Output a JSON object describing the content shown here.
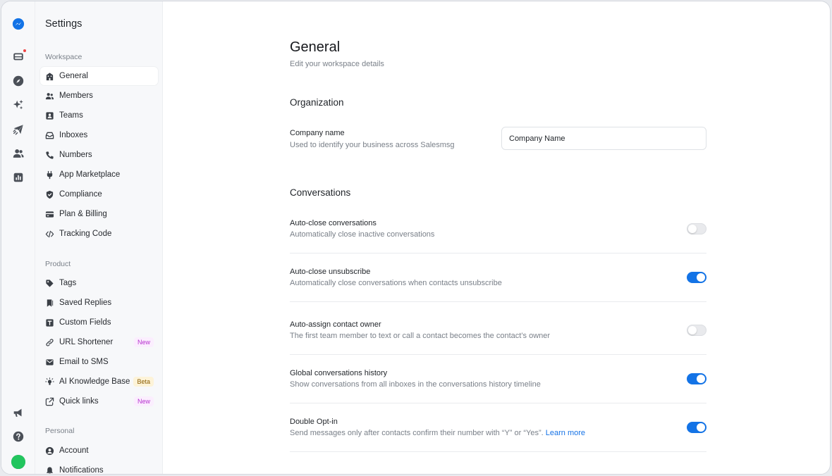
{
  "sidebar": {
    "title": "Settings",
    "sections": [
      {
        "label": "Workspace",
        "items": [
          {
            "label": "General",
            "icon": "building-icon",
            "active": true
          },
          {
            "label": "Members",
            "icon": "users-icon"
          },
          {
            "label": "Teams",
            "icon": "id-card-icon"
          },
          {
            "label": "Inboxes",
            "icon": "inbox-icon"
          },
          {
            "label": "Numbers",
            "icon": "phone-icon"
          },
          {
            "label": "App Marketplace",
            "icon": "plug-icon"
          },
          {
            "label": "Compliance",
            "icon": "shield-check-icon"
          },
          {
            "label": "Plan & Billing",
            "icon": "credit-card-icon"
          },
          {
            "label": "Tracking Code",
            "icon": "code-icon"
          }
        ]
      },
      {
        "label": "Product",
        "items": [
          {
            "label": "Tags",
            "icon": "tag-icon"
          },
          {
            "label": "Saved Replies",
            "icon": "bookmark-icon"
          },
          {
            "label": "Custom Fields",
            "icon": "text-field-icon"
          },
          {
            "label": "URL Shortener",
            "icon": "link-icon",
            "badge": "New"
          },
          {
            "label": "Email to SMS",
            "icon": "envelope-icon"
          },
          {
            "label": "AI Knowledge Base",
            "icon": "lightbulb-icon",
            "badge": "Beta"
          },
          {
            "label": "Quick links",
            "icon": "external-link-icon",
            "badge": "New"
          }
        ]
      },
      {
        "label": "Personal",
        "items": [
          {
            "label": "Account",
            "icon": "user-circle-icon"
          },
          {
            "label": "Notifications",
            "icon": "bell-icon"
          }
        ]
      }
    ]
  },
  "main": {
    "title": "General",
    "subtitle": "Edit your workspace details",
    "organization": {
      "title": "Organization",
      "company_name_label": "Company name",
      "company_name_help": "Used to identify your business across Salesmsg",
      "company_name_value": "Company Name"
    },
    "conversations": {
      "title": "Conversations",
      "settings": [
        {
          "label": "Auto-close conversations",
          "help": "Automatically close inactive conversations",
          "enabled": false
        },
        {
          "label": "Auto-close unsubscribe",
          "help": "Automatically close conversations when contacts unsubscribe",
          "enabled": true
        },
        {
          "label": "Auto-assign contact owner",
          "help": "The first team member to text or call a contact becomes the contact’s owner",
          "enabled": false
        },
        {
          "label": "Global conversations history",
          "help": "Show conversations from all inboxes in the conversations history timeline",
          "enabled": true
        },
        {
          "label": "Double Opt-in",
          "help": "Send messages only after contacts confirm their number with “Y” or “Yes”.",
          "link": "Learn more",
          "enabled": true
        }
      ]
    }
  },
  "colors": {
    "accent": "#1373e6",
    "link": "#1673e6",
    "new_badge_text": "#b632cf",
    "beta_badge_text": "#8a5c00",
    "notification_dot": "#ef4444"
  }
}
